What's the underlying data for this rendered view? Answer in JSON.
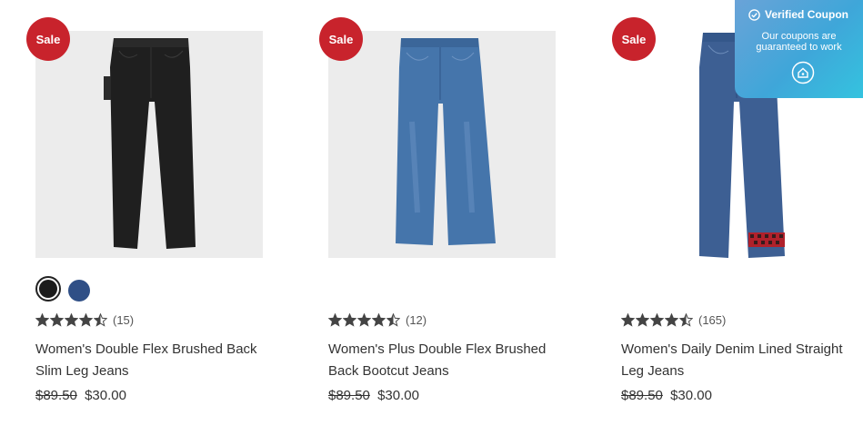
{
  "coupon": {
    "title": "Verified Coupon",
    "message_line1": "Our coupons are",
    "message_line2": "guaranteed to work",
    "icon": "check-circle-icon"
  },
  "products": [
    {
      "badge": "Sale",
      "swatches": [
        {
          "color": "#1c1c1c",
          "selected": true
        },
        {
          "color": "#2f4f86",
          "selected": false
        }
      ],
      "rating": 4.5,
      "reviews": "(15)",
      "title_line1": "Women's Double Flex Brushed Back",
      "title_line2": "Slim Leg Jeans",
      "original_price": "$89.50",
      "sale_price": "$30.00",
      "jeans_color": "#1f1f1f"
    },
    {
      "badge": "Sale",
      "rating": 4.5,
      "reviews": "(12)",
      "title_line1": "Women's Plus Double Flex Brushed",
      "title_line2": "Back Bootcut Jeans",
      "original_price": "$89.50",
      "sale_price": "$30.00",
      "jeans_color": "#4575ab"
    },
    {
      "badge": "Sale",
      "rating": 4.5,
      "reviews": "(165)",
      "title_line1": "Women's Daily Denim Lined Straight",
      "title_line2": "Leg Jeans",
      "original_price": "$89.50",
      "sale_price": "$30.00",
      "jeans_color": "#3d5f93",
      "lining_color": "#b0212b"
    }
  ],
  "colors": {
    "sale_badge": "#c8232c",
    "star": "#444444"
  }
}
